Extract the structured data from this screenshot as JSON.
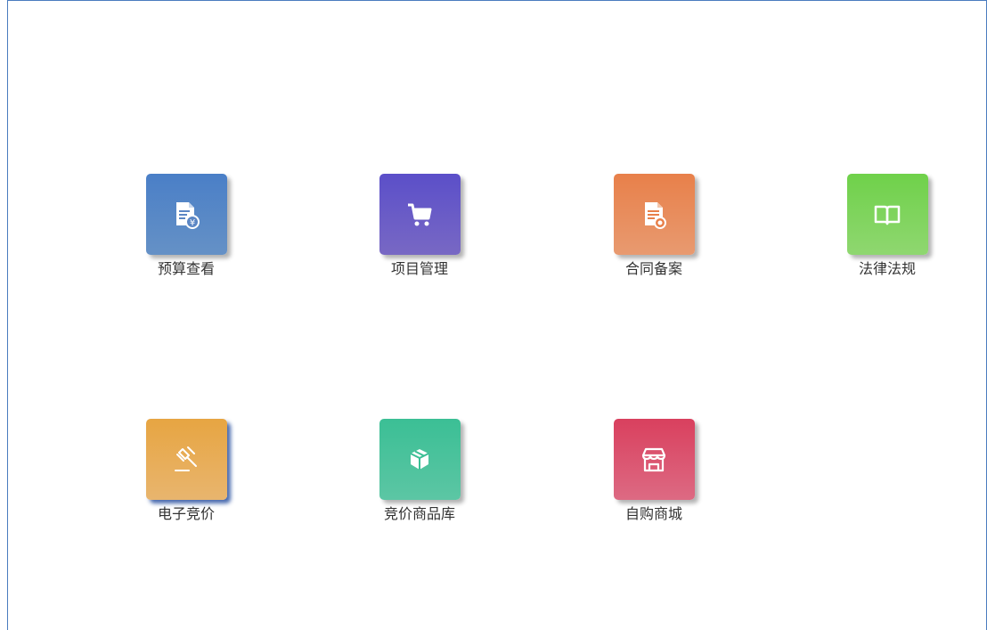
{
  "tiles": [
    {
      "label": "预算查看",
      "icon": "budget-document-icon",
      "color": "#4a7fc7"
    },
    {
      "label": "项目管理",
      "icon": "shopping-cart-icon",
      "color": "#5b4fc9"
    },
    {
      "label": "合同备案",
      "icon": "contract-document-icon",
      "color": "#e8804a"
    },
    {
      "label": "法律法规",
      "icon": "open-book-icon",
      "color": "#6fd14a"
    },
    {
      "label": "电子竞价",
      "icon": "gavel-icon",
      "color": "#e7a542"
    },
    {
      "label": "竞价商品库",
      "icon": "cube-icon",
      "color": "#3bbf95"
    },
    {
      "label": "自购商城",
      "icon": "storefront-icon",
      "color": "#d9405e"
    }
  ]
}
